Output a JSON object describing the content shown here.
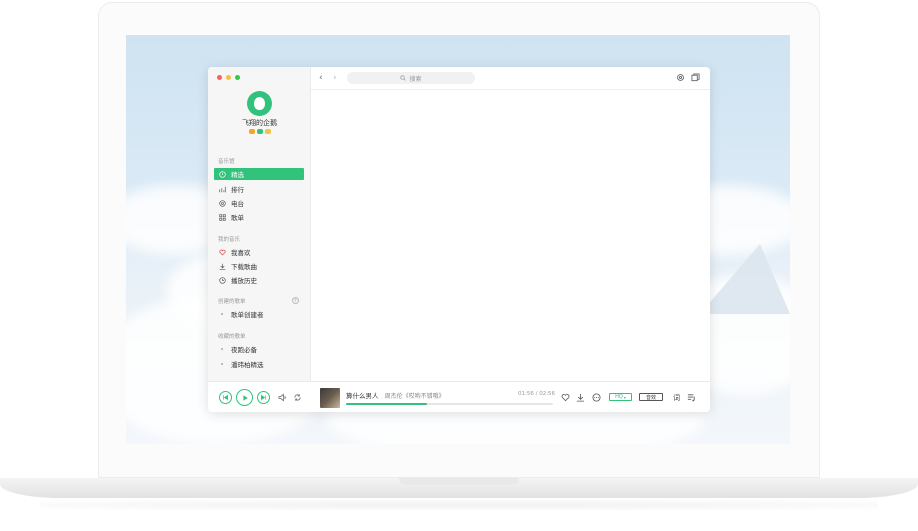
{
  "app": {
    "user": {
      "name": "飞翔的企鹅"
    },
    "sidebar": {
      "section_library": "音乐馆",
      "library_items": [
        {
          "label": "精选",
          "icon": "compass-icon",
          "active": true
        },
        {
          "label": "排行",
          "icon": "chart-icon",
          "active": false
        },
        {
          "label": "电台",
          "icon": "radio-icon",
          "active": false
        },
        {
          "label": "歌单",
          "icon": "grid-icon",
          "active": false
        }
      ],
      "section_mine": "我的音乐",
      "mine_items": [
        {
          "label": "我喜欢",
          "icon": "heart-icon"
        },
        {
          "label": "下载歌曲",
          "icon": "download-icon"
        },
        {
          "label": "播放历史",
          "icon": "clock-icon"
        }
      ],
      "section_created": "创建的歌单",
      "created_items": [
        {
          "label": "歌单创建者"
        }
      ],
      "section_collected": "收藏的歌单",
      "collected_items": [
        {
          "label": "夜跑必备"
        },
        {
          "label": "潘玮柏精选"
        }
      ]
    },
    "topbar": {
      "back_icon": "chevron-left-icon",
      "forward_icon": "chevron-right-icon",
      "search_placeholder": "搜索",
      "settings_icon": "gear-icon",
      "miniplayer_icon": "window-icon"
    },
    "player": {
      "song_title": "算什么男人",
      "artist_album": "周杰伦《哎哟不错哦》",
      "time_display": "01:56 / 02:56",
      "progress": 0.39,
      "quality_label": "HQ",
      "effect_label": "音效",
      "lyrics_label": "词"
    }
  },
  "colors": {
    "accent": "#31c27c",
    "sidebar_bg": "#f6f6f6"
  }
}
